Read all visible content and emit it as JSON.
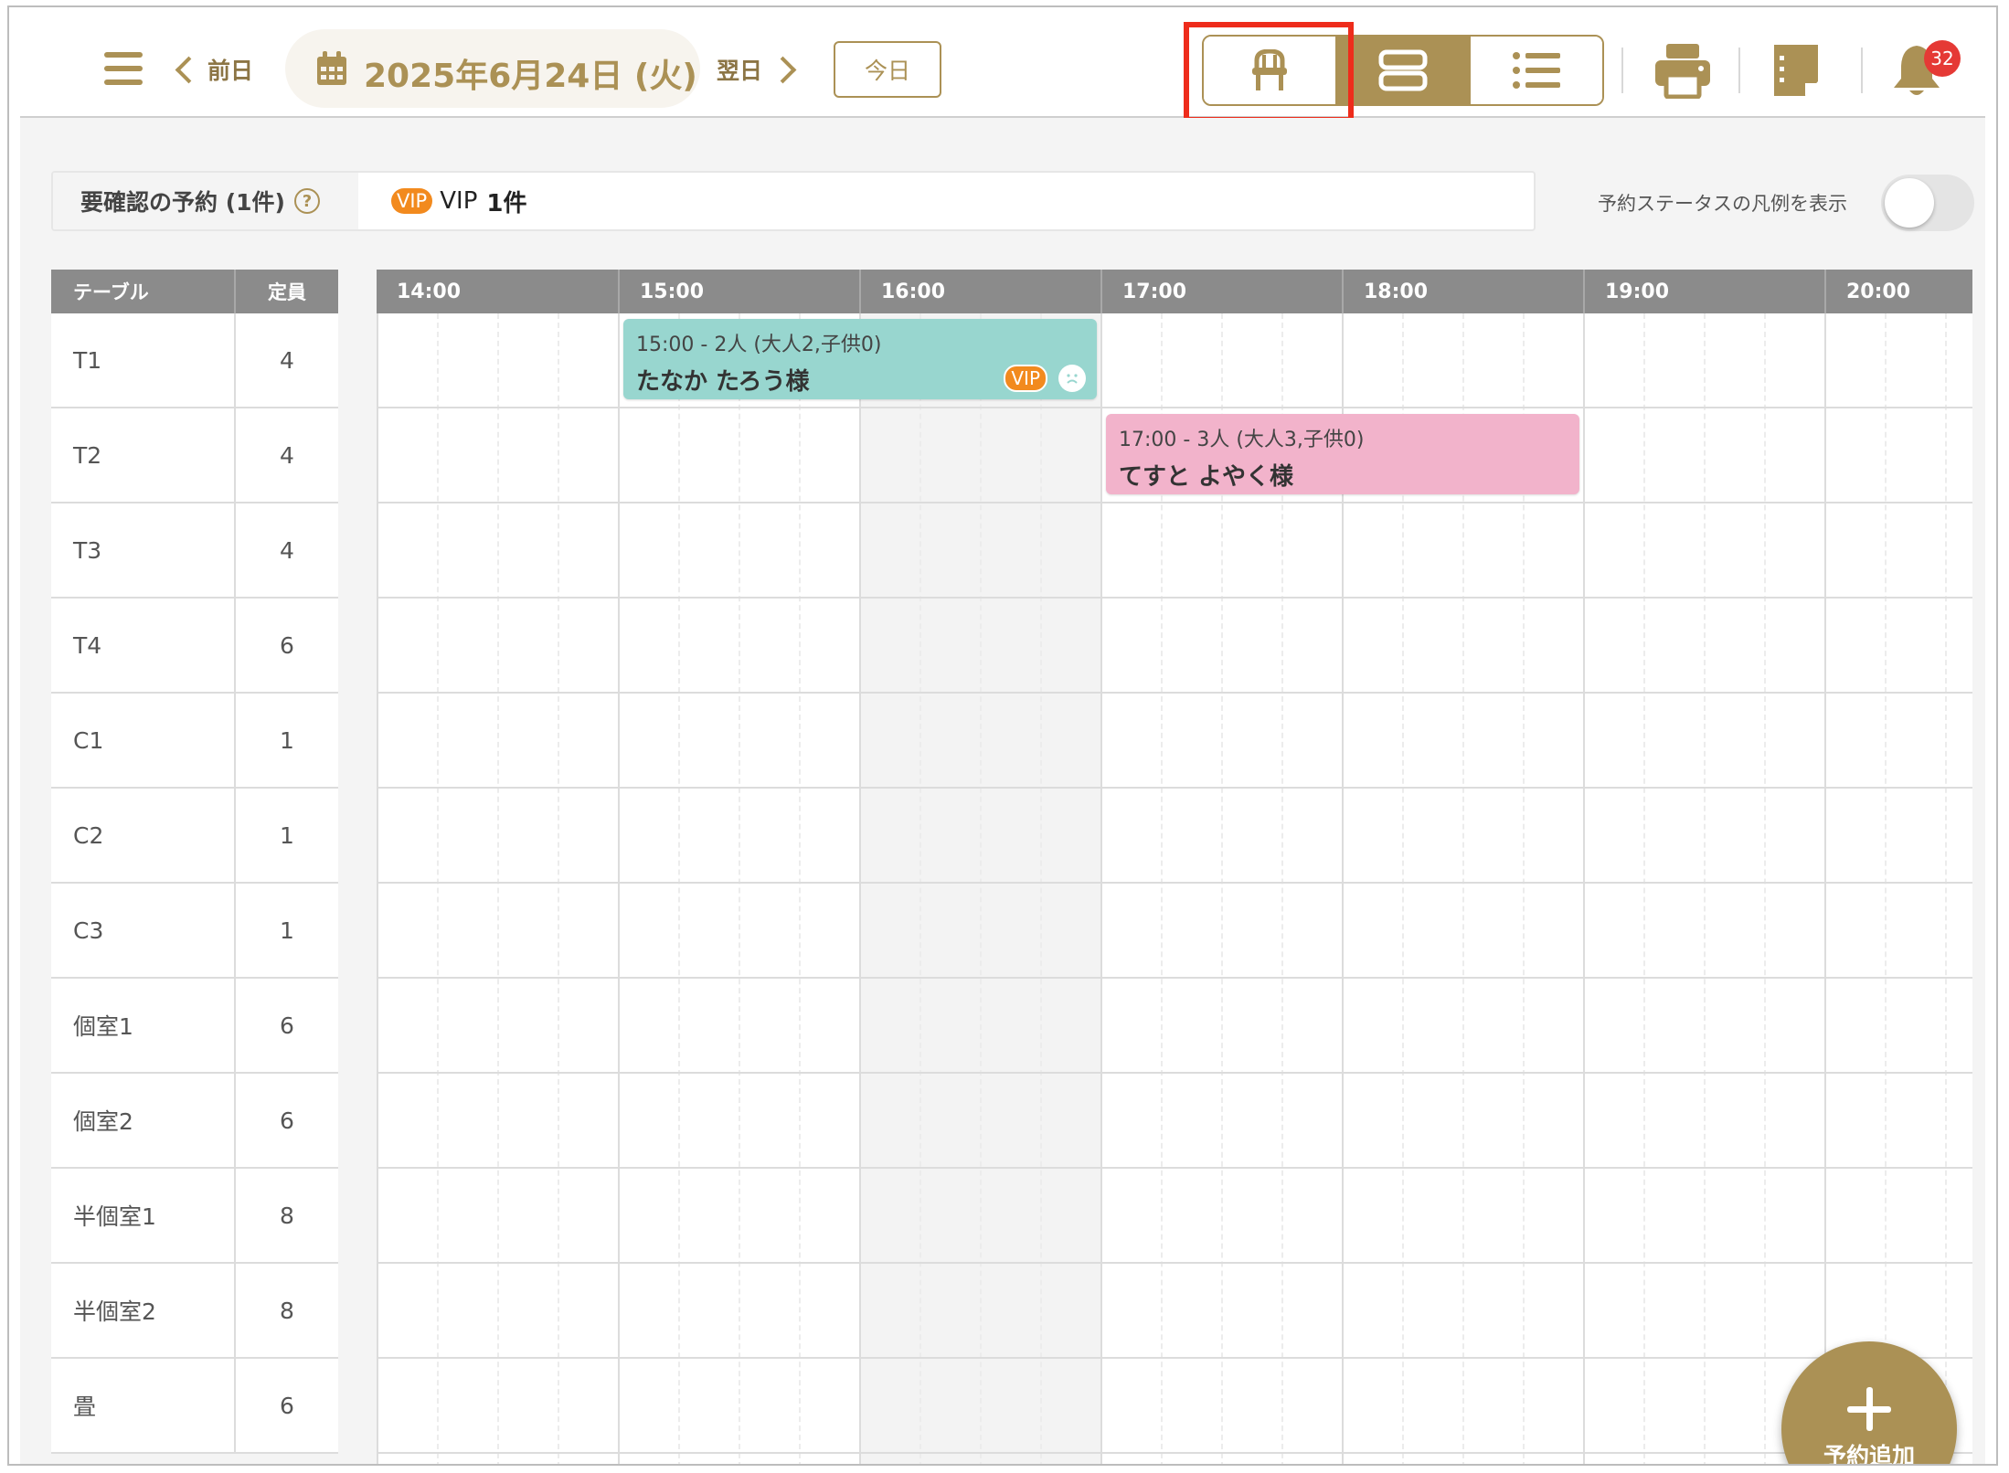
{
  "header": {
    "prev_label": "前日",
    "date": "2025年6月24日 (火)",
    "next_label": "翌日",
    "today_label": "今日",
    "view_modes": [
      {
        "name": "table-seat-view",
        "icon": "chair-icon",
        "active": false
      },
      {
        "name": "timeline-view",
        "icon": "rows-icon",
        "active": true
      },
      {
        "name": "list-view",
        "icon": "list-icon",
        "active": false
      }
    ],
    "notification_count": "32"
  },
  "alert": {
    "label": "要確認の予約 (1件)",
    "help": "?",
    "vip_tag": "VIP",
    "value_text": "VIP",
    "value_count": "1件"
  },
  "legend_toggle_label": "予約ステータスの凡例を表示",
  "table_list": {
    "headers": {
      "table": "テーブル",
      "capacity": "定員"
    },
    "rows": [
      {
        "name": "T1",
        "capacity": "4"
      },
      {
        "name": "T2",
        "capacity": "4"
      },
      {
        "name": "T3",
        "capacity": "4"
      },
      {
        "name": "T4",
        "capacity": "6"
      },
      {
        "name": "C1",
        "capacity": "1"
      },
      {
        "name": "C2",
        "capacity": "1"
      },
      {
        "name": "C3",
        "capacity": "1"
      },
      {
        "name": "個室1",
        "capacity": "6"
      },
      {
        "name": "個室2",
        "capacity": "6"
      },
      {
        "name": "半個室1",
        "capacity": "8"
      },
      {
        "name": "半個室2",
        "capacity": "8"
      },
      {
        "name": "畳",
        "capacity": "6"
      }
    ]
  },
  "timeline": {
    "hours": [
      "14:00",
      "15:00",
      "16:00",
      "17:00",
      "18:00",
      "19:00",
      "20:00"
    ],
    "reservations": [
      {
        "row": 0,
        "start": "15:00",
        "end": "17:00",
        "time_text": "15:00 - 2人 (大人2,子供0)",
        "name": "たなか たろう様",
        "vip": "VIP",
        "color": "#98d6cf"
      },
      {
        "row": 1,
        "start": "17:00",
        "end": "19:00",
        "time_text": "17:00 - 3人 (大人3,子供0)",
        "name": "てすと よやく様",
        "vip": null,
        "color": "#f2b3cb"
      }
    ]
  },
  "fab_label": "予約追加",
  "colors": {
    "accent": "#ab9155",
    "highlight": "#ee2c1b",
    "badge": "#e53935",
    "vip": "#f28a1e"
  }
}
